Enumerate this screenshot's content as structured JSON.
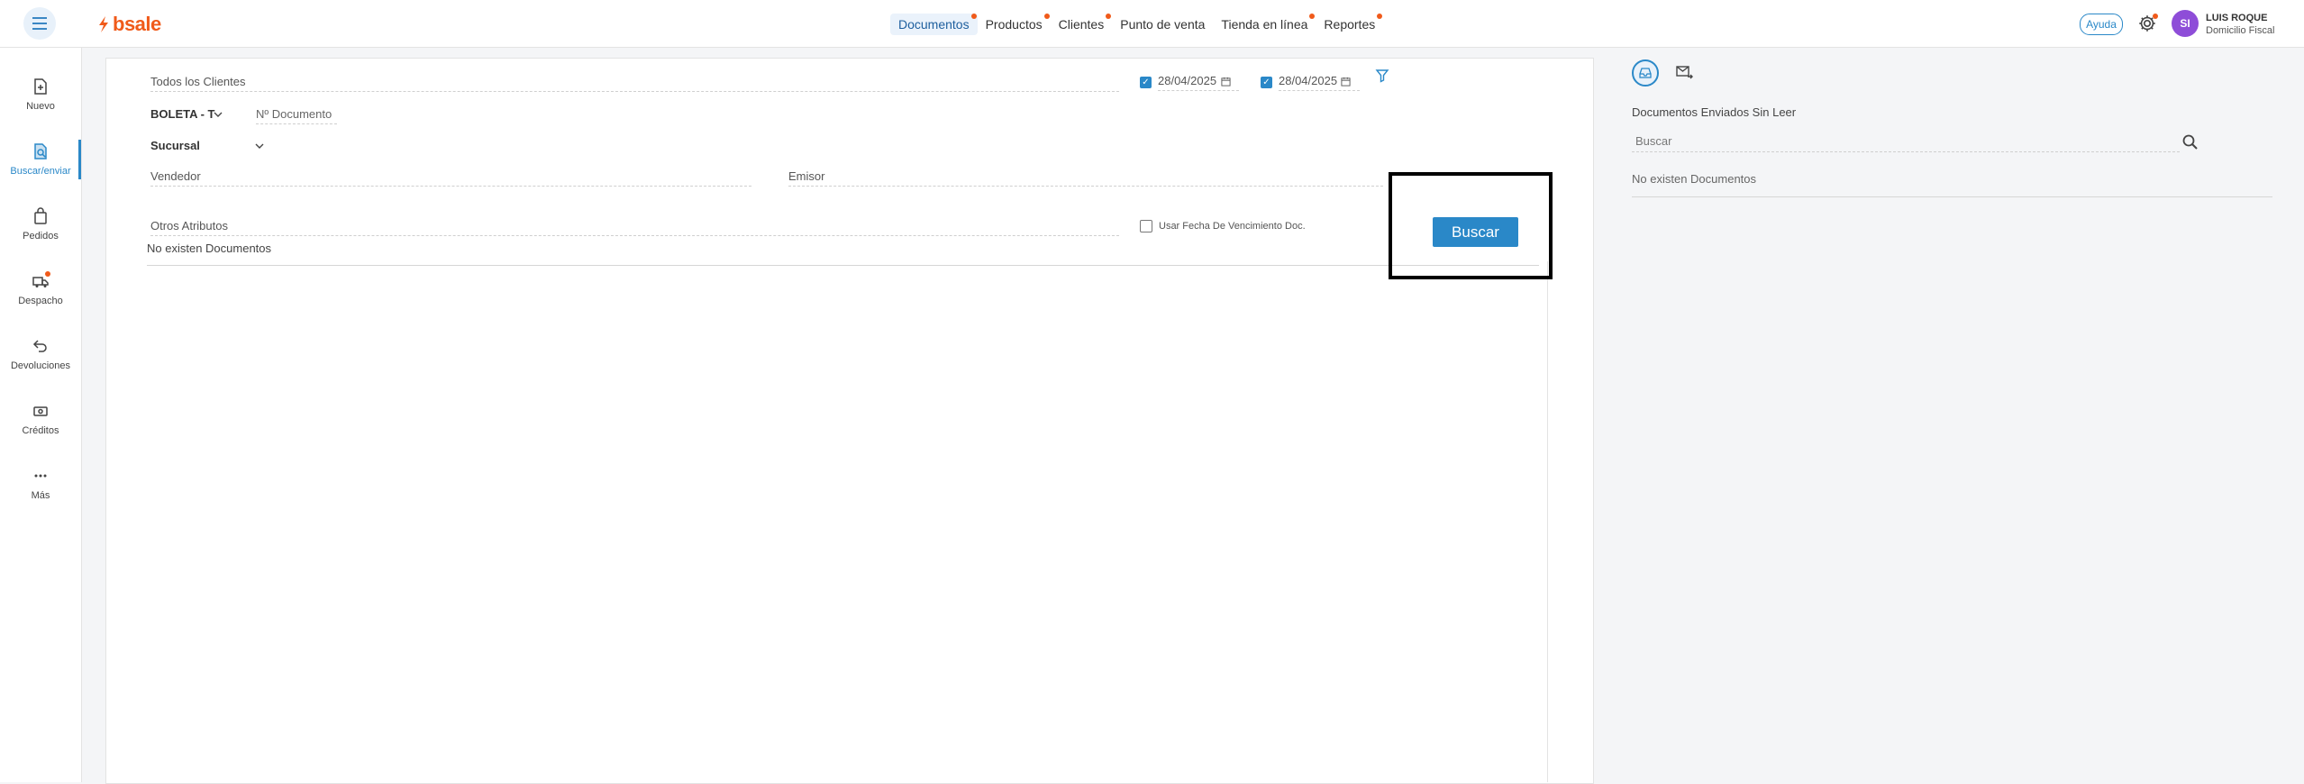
{
  "header": {
    "logo": "bsale",
    "nav": [
      {
        "label": "Documentos",
        "active": true,
        "dot": true
      },
      {
        "label": "Productos",
        "active": false,
        "dot": true
      },
      {
        "label": "Clientes",
        "active": false,
        "dot": true
      },
      {
        "label": "Punto de venta",
        "active": false,
        "dot": false
      },
      {
        "label": "Tienda en línea",
        "active": false,
        "dot": true
      },
      {
        "label": "Reportes",
        "active": false,
        "dot": true
      }
    ],
    "help_label": "Ayuda",
    "avatar_initials": "SI",
    "user_name": "LUIS ROQUE",
    "user_sub": "Domicilio Fiscal"
  },
  "sidebar": {
    "items": [
      {
        "label": "Nuevo",
        "icon": "new-document-icon"
      },
      {
        "label": "Buscar/enviar",
        "icon": "search-document-icon",
        "active": true
      },
      {
        "label": "Pedidos",
        "icon": "bag-icon"
      },
      {
        "label": "Despacho",
        "icon": "truck-icon",
        "dot": true
      },
      {
        "label": "Devoluciones",
        "icon": "return-arrow-icon"
      },
      {
        "label": "Créditos",
        "icon": "credit-icon"
      },
      {
        "label": "Más",
        "icon": "more-dots-icon"
      }
    ]
  },
  "search": {
    "clients_placeholder": "Todos los Clientes",
    "date_from": "28/04/2025",
    "date_to": "28/04/2025",
    "doc_type": "BOLETA - T",
    "doc_number_placeholder": "Nº Documento",
    "branch": "Sucursal",
    "seller_placeholder": "Vendedor",
    "issuer_placeholder": "Emisor",
    "other_attrs_placeholder": "Otros Atributos",
    "due_date_checkbox_label": "Usar Fecha De Vencimiento Doc.",
    "search_button": "Buscar",
    "empty_message": "No existen Documentos"
  },
  "right_panel": {
    "title": "Documentos Enviados Sin Leer",
    "search_placeholder": "Buscar",
    "empty_message": "No existen Documentos"
  },
  "colors": {
    "accent": "#2a88c8",
    "brand": "#f05a1a",
    "avatar": "#8e4dd8"
  }
}
